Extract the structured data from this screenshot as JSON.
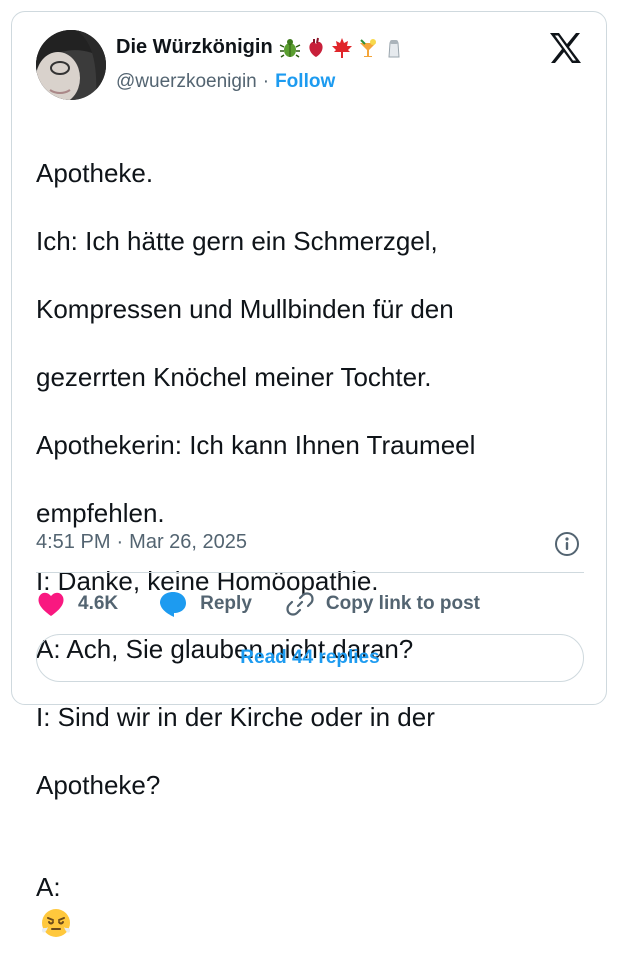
{
  "author": {
    "display_name": "Die Würzkönigin",
    "handle": "@wuerzkoenigin",
    "separator": "·",
    "follow_label": "Follow",
    "name_emojis": [
      "bug-icon",
      "anatomical-heart-icon",
      "maple-leaf-icon",
      "tropical-drink-icon",
      "salt-shaker-icon"
    ]
  },
  "tweet": {
    "lines": [
      "Apotheke.",
      "Ich: Ich hätte gern ein Schmerzgel,",
      "Kompressen und Mullbinden für den",
      "gezerrten Knöchel meiner Tochter.",
      "Apothekerin: Ich kann Ihnen Traumeel",
      "empfehlen.",
      "I: Danke, keine Homöopathie.",
      "A: Ach, Sie glauben nicht daran?",
      "I: Sind wir in der Kirche oder in der",
      "Apotheke?"
    ],
    "last_line_prefix": "A:",
    "last_line_emoji": "face-with-steam-icon"
  },
  "meta": {
    "time": "4:51 PM",
    "separator": "·",
    "date": "Mar 26, 2025"
  },
  "actions": {
    "likes": "4.6K",
    "reply_label": "Reply",
    "copy_link_label": "Copy link to post"
  },
  "read_replies_label": "Read 44 replies",
  "colors": {
    "text": "#0f1419",
    "secondary": "#536471",
    "accent": "#1d9bf0",
    "like": "#f91880",
    "border": "#cfd9de"
  }
}
